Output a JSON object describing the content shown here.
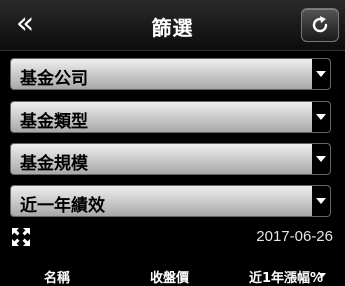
{
  "header": {
    "back_icon": "double-chevron-left-icon",
    "title": "篩選",
    "refresh_icon": "refresh-icon"
  },
  "filters": [
    {
      "label": "基金公司"
    },
    {
      "label": "基金類型"
    },
    {
      "label": "基金規模"
    },
    {
      "label": "近一年績效"
    }
  ],
  "info": {
    "expand_icon": "expand-arrows-icon",
    "date": "2017-06-26"
  },
  "table": {
    "columns": [
      "名稱",
      "收盤價",
      "近1年漲幅%"
    ],
    "sort_icon": "caret-down-icon"
  },
  "colors": {
    "background": "#000000",
    "dropdown_top": "#eeeeee",
    "dropdown_bottom": "#a8a8a8",
    "text": "#ffffff"
  }
}
